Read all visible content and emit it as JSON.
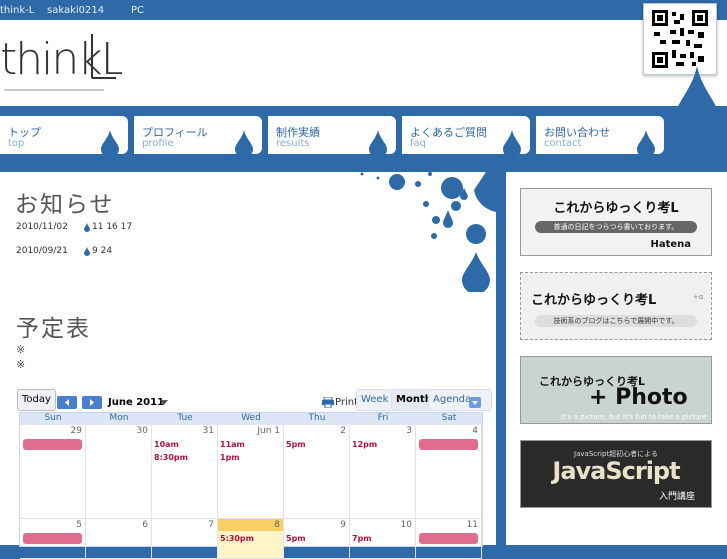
{
  "topbar": {
    "site": "think-L",
    "user": "sakaki0214",
    "mode": "PC"
  },
  "logo": {
    "text": "thinkL"
  },
  "nav": [
    {
      "jp": "トップ",
      "en": "top"
    },
    {
      "jp": "プロフィール",
      "en": "profile"
    },
    {
      "jp": "制作実績",
      "en": "results"
    },
    {
      "jp": "よくあるご質問",
      "en": "faq"
    },
    {
      "jp": "お問い合わせ",
      "en": "contact"
    }
  ],
  "news": {
    "heading": "お知らせ",
    "items": [
      {
        "date": "2010/11/02",
        "text": "11 16 17"
      },
      {
        "date": "2010/09/21",
        "text": "9 24"
      }
    ]
  },
  "schedule": {
    "heading": "予定表",
    "notes": [
      "※",
      "※"
    ]
  },
  "calendar": {
    "today": "Today",
    "month": "June 2011",
    "print": "Print",
    "week": "Week",
    "monthview": "Month",
    "agenda": "Agenda",
    "days": [
      "Sun",
      "Mon",
      "Tue",
      "Wed",
      "Thu",
      "Fri",
      "Sat"
    ],
    "rows": [
      {
        "nums": [
          "29",
          "30",
          "31",
          "Jun 1",
          "2",
          "3",
          "4"
        ],
        "events": [
          [],
          [],
          [
            "10am",
            "8:30pm"
          ],
          [
            "11am",
            "1pm"
          ],
          [
            "5pm"
          ],
          [
            "12pm"
          ],
          []
        ],
        "bars": [
          0,
          6
        ]
      },
      {
        "nums": [
          "5",
          "6",
          "7",
          "8",
          "9",
          "10",
          "11"
        ],
        "events": [
          [],
          [],
          [],
          [
            "5:30pm"
          ],
          [
            "5pm"
          ],
          [
            "7pm"
          ],
          []
        ],
        "bars": [
          0,
          6
        ]
      }
    ]
  },
  "sidebar": {
    "b1": {
      "title": "これからゆっくり考L",
      "sub": "普通の日記をつらつら書いております。",
      "brand": "Hatena"
    },
    "b2": {
      "title": "これからゆっくり考L",
      "tag": "+α",
      "sub": "技術系のブログはこちらで展開中です。"
    },
    "b3": {
      "title": "これからゆっくり考L",
      "plus": "+ Photo",
      "caption": "It's a picture, but it's fun to take a picture"
    },
    "b4": {
      "top": "JavaScript超初心者による",
      "title": "JavaScript",
      "sub": "入門講座"
    }
  },
  "colors": {
    "brand": "#2e6aa8",
    "event": "#b0123f",
    "bar": "#e06c8e"
  }
}
